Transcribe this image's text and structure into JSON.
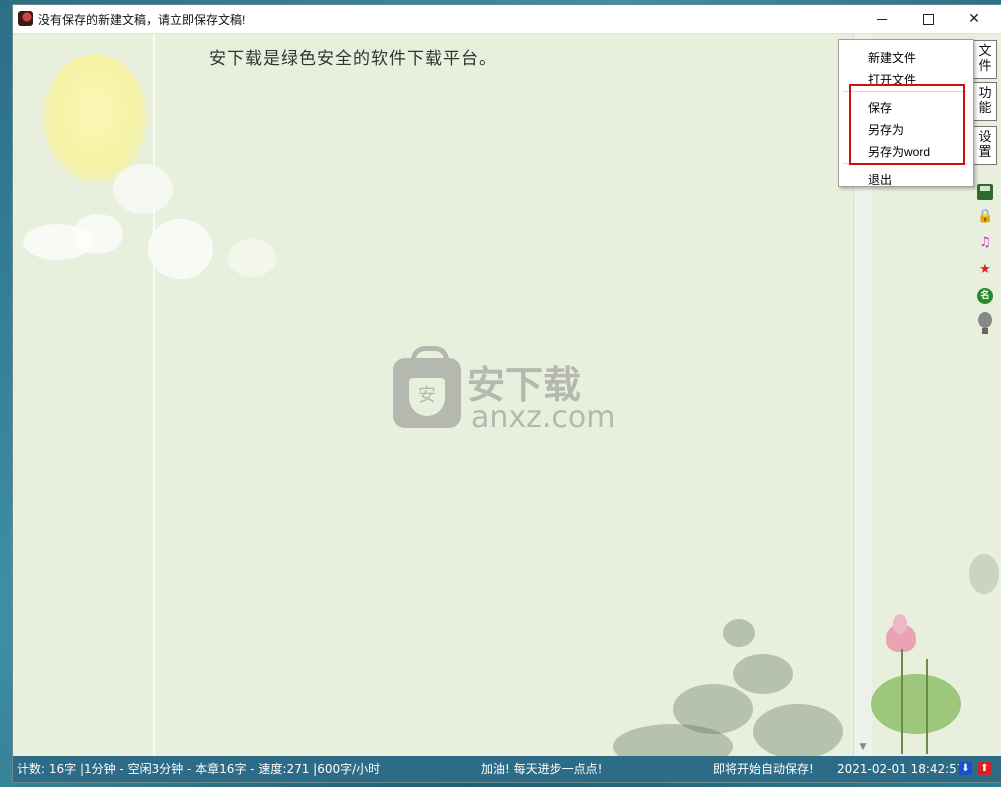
{
  "window": {
    "title": "没有保存的新建文稿，请立即保存文稿!",
    "controls": [
      "minimize",
      "maximize",
      "close"
    ]
  },
  "editor": {
    "text": "安下载是绿色安全的软件下载平台。",
    "watermark_cn": "安下载",
    "watermark_en": "anxz.com",
    "watermark_badge": "安"
  },
  "menu": {
    "items": [
      {
        "label": "新建文件",
        "highlighted": false
      },
      {
        "label": "打开文件",
        "highlighted": false
      },
      {
        "label": "保存",
        "highlighted": true
      },
      {
        "label": "另存为",
        "highlighted": true
      },
      {
        "label": "另存为word",
        "highlighted": true
      },
      {
        "label": "退出",
        "highlighted": false
      }
    ],
    "highlight_color": "#d01010"
  },
  "side_tabs": [
    {
      "label": "文件"
    },
    {
      "label": "功能"
    },
    {
      "label": "设置"
    }
  ],
  "side_icons": [
    "save-icon",
    "lock-icon",
    "music-icon",
    "star-icon",
    "name-icon",
    "lightbulb-icon"
  ],
  "status": {
    "count": "计数: 16字 |1分钟 - 空闲3分钟 - 本章16字 - 速度:271 |600字/小时",
    "slogan": "加油! 每天进步一点点!",
    "autosave": "即将开始自动保存!",
    "datetime": "2021-02-01 18:42:57"
  },
  "colors": {
    "paper": "#e8efdc",
    "statusbar": "#2e6b87",
    "accent_red": "#d01010"
  }
}
